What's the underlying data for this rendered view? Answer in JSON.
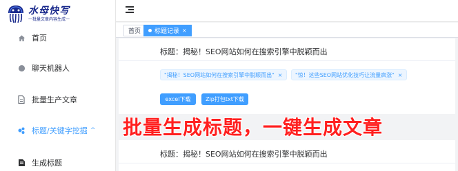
{
  "app": {
    "logo_title": "水母快写",
    "logo_subtitle": "一批量文章内容生成一"
  },
  "sidebar": {
    "items": [
      {
        "label": "首页",
        "icon": "home-icon"
      },
      {
        "label": "聊天机器人",
        "icon": "chat-bot-icon"
      },
      {
        "label": "批量生产文章",
        "icon": "document-icon"
      },
      {
        "label": "标题/关键字挖掘",
        "icon": "tag-icon",
        "arrow": "^"
      },
      {
        "label": "生成标题",
        "icon": "generate-icon"
      }
    ]
  },
  "tabs": [
    {
      "label": "首页"
    },
    {
      "label": "标题记录",
      "close": "×"
    }
  ],
  "cards": [
    {
      "title": "标题：揭秘！SEO网站如何在搜索引擎中脱颖而出",
      "chips": [
        {
          "label": "\"揭秘！SEO网站如何在搜索引擎中脱颖而出\"",
          "close": "×"
        },
        {
          "label": "\"惊！这些SEO网站优化技巧让流量疯涨\"",
          "close": "×"
        }
      ],
      "buttons": [
        {
          "label": "excel下载"
        },
        {
          "label": "Zip打包txt下载"
        }
      ]
    },
    {
      "title": "标题：揭秘！SEO网站如何在搜索引擎中脱颖而出"
    }
  ],
  "overlay_caption": "批量生成标题，一键生成文章",
  "colors": {
    "accent": "#409eff",
    "brand": "#1a2a8c",
    "caption": "#ff1f1f"
  }
}
